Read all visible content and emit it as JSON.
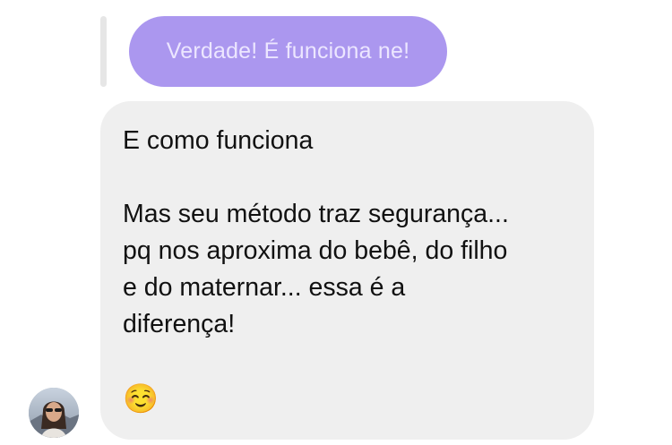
{
  "quoted_message": {
    "text": "Verdade! É funciona ne!"
  },
  "message": {
    "lines": [
      "E como funciona",
      "",
      "Mas seu método traz segurança...",
      "pq nos aproxima do bebê, do filho",
      "e do maternar... essa é a",
      "diferença!",
      ""
    ],
    "emoji": "☺️"
  },
  "sender": {
    "avatar_icon": "profile-photo-avatar"
  },
  "colors": {
    "quoted_bubble": "#ab97ef",
    "quoted_text": "#ece6ff",
    "message_bubble": "#efefef",
    "message_text": "#111111",
    "reply_bar": "#e6e6e6"
  }
}
